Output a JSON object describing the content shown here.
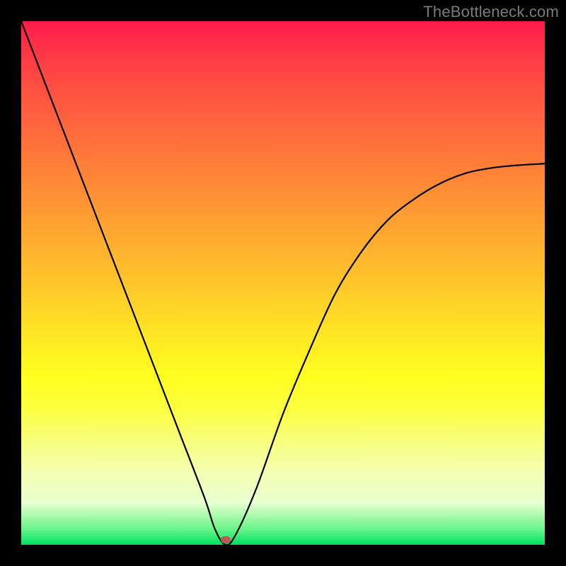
{
  "watermark": "TheBottleneck.com",
  "chart_data": {
    "type": "line",
    "title": "",
    "xlabel": "",
    "ylabel": "",
    "xlim": [
      0,
      100
    ],
    "ylim": [
      0,
      100
    ],
    "grid": false,
    "legend": false,
    "series": [
      {
        "name": "bottleneck-curve",
        "x": [
          0,
          5,
          10,
          15,
          20,
          25,
          30,
          35,
          37,
          39,
          41,
          45,
          50,
          55,
          60,
          65,
          70,
          75,
          80,
          85,
          90,
          95,
          100
        ],
        "y": [
          100,
          87,
          74,
          61,
          48,
          35,
          22,
          9,
          3,
          0,
          2,
          11,
          25,
          37,
          48,
          56,
          62,
          66,
          69,
          71,
          72,
          72.5,
          72.8
        ]
      }
    ],
    "marker": {
      "x": 39,
      "y": 1
    },
    "background_gradient": {
      "top": "#ff1a4b",
      "middle": "#ffff1f",
      "bottom": "#00e060"
    }
  }
}
